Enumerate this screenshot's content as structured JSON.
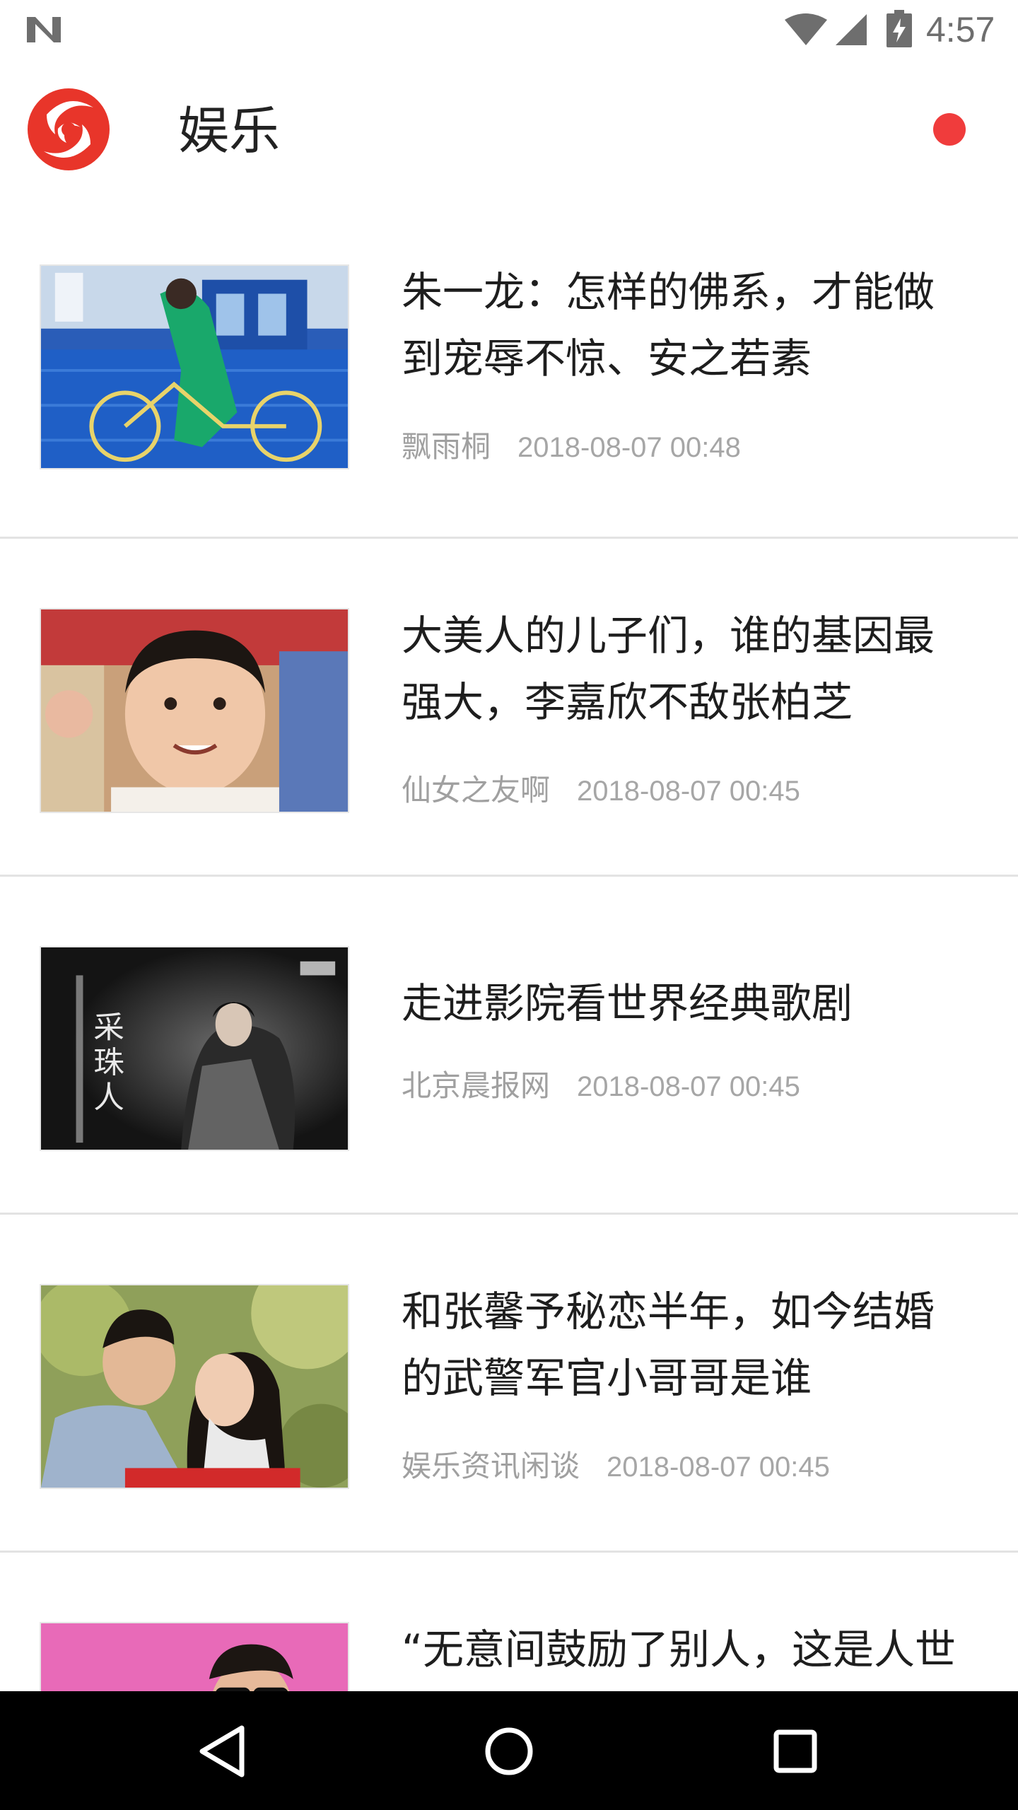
{
  "status_bar": {
    "time": "4:57",
    "icons": [
      "n-logo-icon",
      "wifi-icon",
      "cell-signal-icon",
      "battery-charging-icon"
    ]
  },
  "header": {
    "title": "娱乐",
    "logo_icon": "phoenix-logo-icon",
    "notification_color": "#f03c3c"
  },
  "feed": {
    "articles": [
      {
        "title": "朱一龙：怎样的佛系，才能做到宠辱不惊、安之若素",
        "source": "飘雨桐",
        "time": "2018-08-07 00:48"
      },
      {
        "title": "大美人的儿子们，谁的基因最强大，李嘉欣不敌张柏芝",
        "source": "仙女之友啊",
        "time": "2018-08-07 00:45"
      },
      {
        "title": "走进影院看世界经典歌剧",
        "source": "北京晨报网",
        "time": "2018-08-07 00:45"
      },
      {
        "title": "和张馨予秘恋半年，如今结婚的武警军官小哥哥是谁",
        "source": "娱乐资讯闲谈",
        "time": "2018-08-07 00:45"
      },
      {
        "title": "“无意间鼓励了别人，这是人世",
        "source": "",
        "time": ""
      }
    ]
  },
  "nav_bar": {
    "icons": [
      "back-triangle-icon",
      "home-circle-icon",
      "recents-square-icon"
    ]
  }
}
